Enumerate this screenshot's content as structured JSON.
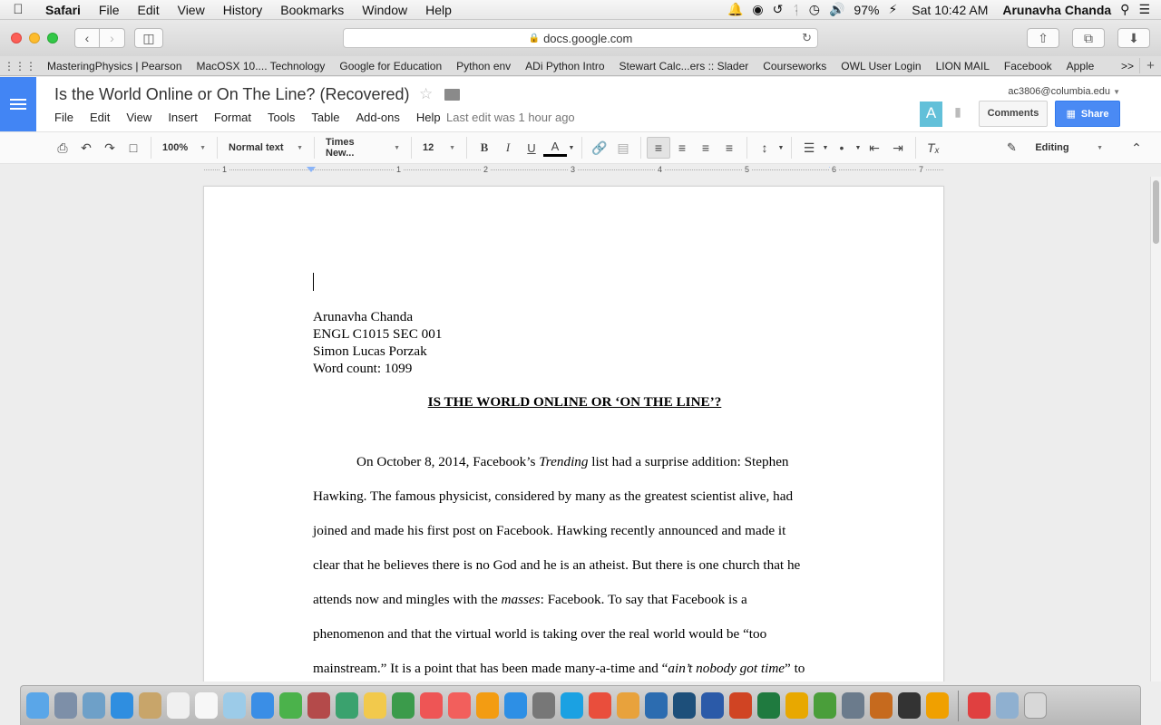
{
  "menubar": {
    "app_name": "Safari",
    "items": [
      "File",
      "Edit",
      "View",
      "History",
      "Bookmarks",
      "Window",
      "Help"
    ],
    "battery": "97%",
    "clock": "Sat 10:42 AM",
    "user": "Arunavha Chanda"
  },
  "safari": {
    "url": "docs.google.com"
  },
  "bookmarks": [
    "MasteringPhysics | Pearson",
    "MacOSX 10.... Technology",
    "Google for Education",
    "Python env",
    "ADi Python Intro",
    "Stewart Calc...ers :: Slader",
    "Courseworks",
    "OWL User Login",
    "LION MAIL",
    "Facebook",
    "Apple"
  ],
  "bookmarks_more": ">>",
  "docs": {
    "title": "Is the World Online or On The Line? (Recovered)",
    "menus": [
      "File",
      "Edit",
      "View",
      "Insert",
      "Format",
      "Tools",
      "Table",
      "Add-ons",
      "Help"
    ],
    "last_edit": "Last edit was 1 hour ago",
    "account": "ac3806@columbia.edu",
    "avatar_letter": "A",
    "comments_label": "Comments",
    "share_label": "Share",
    "brand_color": "#4285f4"
  },
  "toolbar": {
    "zoom": "100%",
    "style": "Normal text",
    "font": "Times New...",
    "size": "12",
    "bold": "B",
    "italic": "I",
    "underline": "U",
    "text_color": "A",
    "mode": "Editing"
  },
  "ruler": {
    "numbers": [
      "1",
      "1",
      "2",
      "3",
      "4",
      "5",
      "6",
      "7"
    ]
  },
  "document": {
    "header_lines": [
      "Arunavha Chanda",
      "ENGL C1015 SEC 001",
      "Simon Lucas Porzak",
      "Word count: 1099"
    ],
    "heading": "IS THE WORLD ONLINE OR ‘ON THE LINE’?",
    "body_lines": [
      [
        {
          "t": "On October 8, 2014, Facebook’s "
        },
        {
          "t": "Trending",
          "i": true
        },
        {
          "t": " list had a surprise addition: Stephen"
        }
      ],
      [
        {
          "t": "Hawking. The famous physicist, considered by many as the greatest scientist alive, had"
        }
      ],
      [
        {
          "t": "joined and made his first post on Facebook. Hawking recently announced and made it"
        }
      ],
      [
        {
          "t": "clear that he believes there is no God and he is an atheist. But there is one church that he"
        }
      ],
      [
        {
          "t": "attends now and mingles with the "
        },
        {
          "t": "masses",
          "i": true
        },
        {
          "t": ": Facebook. To say that Facebook is a"
        }
      ],
      [
        {
          "t": "phenomenon and that the virtual world is taking over the real world would be “too"
        }
      ],
      [
        {
          "t": "mainstream.” It is a point that has been made many-a-time and “"
        },
        {
          "t": "ain’t nobody got time",
          "i": true
        },
        {
          "t": "” to"
        }
      ]
    ]
  }
}
